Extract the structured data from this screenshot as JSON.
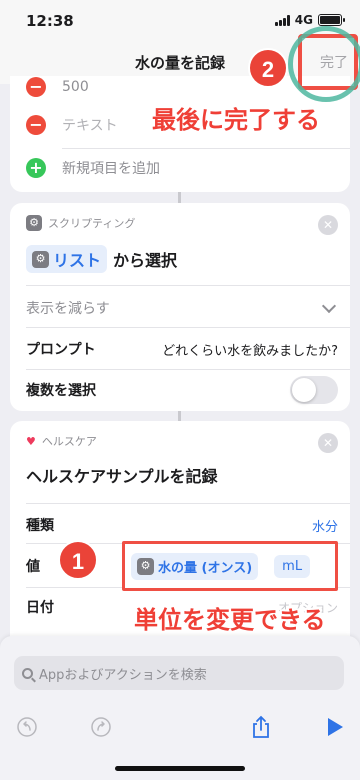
{
  "status": {
    "time": "12:38",
    "network": "4G"
  },
  "nav": {
    "title": "水の量を記録",
    "done": "完了"
  },
  "list_card": {
    "items": [
      {
        "label": "500"
      },
      {
        "label": "テキスト"
      }
    ],
    "add_label": "新規項目を追加"
  },
  "scripting_card": {
    "category": "スクリプティング",
    "action_token": "リスト",
    "action_suffix": "から選択",
    "show_less": "表示を減らす",
    "prompt_label": "プロンプト",
    "prompt_value": "どれくらい水を飲みましたか?",
    "multi_label": "複数を選択"
  },
  "health_card": {
    "category": "ヘルスケア",
    "title": "ヘルスケアサンプルを記録",
    "type_label": "種類",
    "type_value": "水分",
    "value_label": "値",
    "value_token": "水の量 (オンス)",
    "unit_token": "mL",
    "date_label": "日付",
    "date_value": "オプション"
  },
  "annotations": {
    "badge1": "1",
    "badge2": "2",
    "text_done": "最後に完了する",
    "text_unit": "単位を変更できる",
    "color": "#ef3f36"
  },
  "bottom": {
    "search_placeholder": "Appおよびアクションを検索"
  }
}
